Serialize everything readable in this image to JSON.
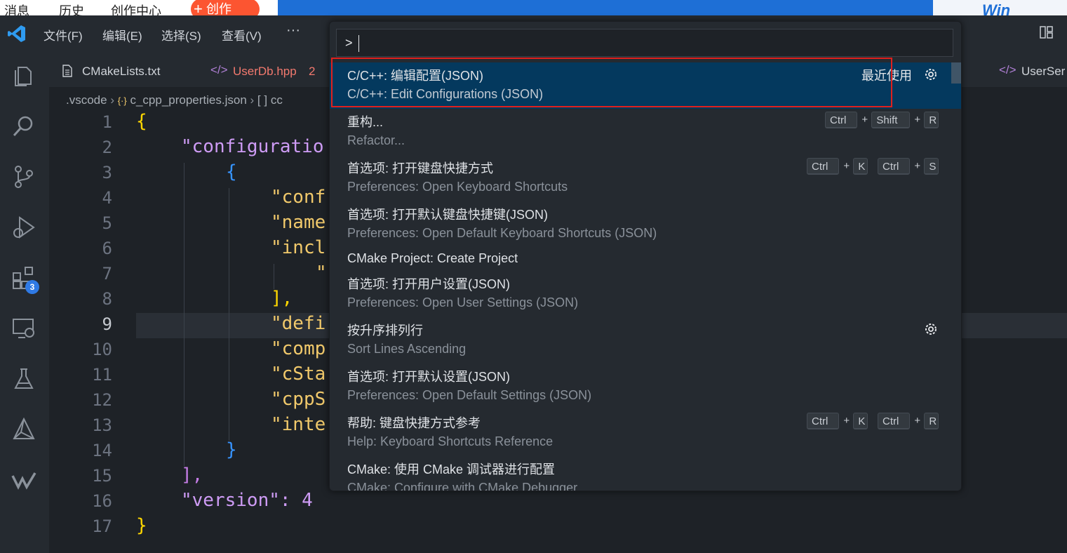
{
  "browser": {
    "tabs": [
      "消息",
      "历史",
      "创作中心"
    ],
    "create_button": "创作",
    "right_text": "Win"
  },
  "titlebar": {
    "menus": [
      "文件(F)",
      "编辑(E)",
      "选择(S)",
      "查看(V)"
    ],
    "more": "···"
  },
  "activity": {
    "extensions_badge": "3"
  },
  "tabs": [
    {
      "label": "CMakeLists.txt",
      "color": "#d0d4da"
    },
    {
      "label": "UserDb.hpp",
      "badge": "2",
      "color": "#f2796e"
    },
    {
      "label": "UserSer",
      "color": "#d0d4da"
    }
  ],
  "breadcrumb": {
    "folder": ".vscode",
    "file": "c_cpp_properties.json",
    "symbol": "[ ] cc"
  },
  "editor": {
    "line_numbers": [
      "1",
      "2",
      "3",
      "4",
      "5",
      "6",
      "7",
      "8",
      "9",
      "10",
      "11",
      "12",
      "13",
      "14",
      "15",
      "16",
      "17"
    ],
    "current_line": "9",
    "lines": [
      "{",
      "\"configuratio",
      "{",
      "\"conf",
      "\"name",
      "\"incl",
      "\"",
      "],",
      "\"defi",
      "\"comp",
      "\"cSta",
      "\"cppS",
      "\"inte",
      "}",
      "],",
      "\"version\": 4",
      "}"
    ]
  },
  "palette": {
    "input_value": ">",
    "recent_label": "最近使用",
    "items": [
      {
        "title": "C/C++: 编辑配置(JSON)",
        "subtitle": "C/C++: Edit Configurations (JSON)",
        "selected": true
      },
      {
        "title": "重构...",
        "subtitle": "Refactor...",
        "keys": [
          [
            "Ctrl",
            "Shift",
            "R"
          ]
        ]
      },
      {
        "title": "首选项: 打开键盘快捷方式",
        "subtitle": "Preferences: Open Keyboard Shortcuts",
        "keys": [
          [
            "Ctrl",
            "K"
          ],
          [
            "Ctrl",
            "S"
          ]
        ]
      },
      {
        "title": "首选项: 打开默认键盘快捷键(JSON)",
        "subtitle": "Preferences: Open Default Keyboard Shortcuts (JSON)"
      },
      {
        "title": "CMake Project: Create Project",
        "subtitle": ""
      },
      {
        "title": "首选项: 打开用户设置(JSON)",
        "subtitle": "Preferences: Open User Settings (JSON)"
      },
      {
        "title": "按升序排列行",
        "subtitle": "Sort Lines Ascending",
        "gear": true
      },
      {
        "title": "首选项: 打开默认设置(JSON)",
        "subtitle": "Preferences: Open Default Settings (JSON)"
      },
      {
        "title": "帮助: 键盘快捷方式参考",
        "subtitle": "Help: Keyboard Shortcuts Reference",
        "keys": [
          [
            "Ctrl",
            "K"
          ],
          [
            "Ctrl",
            "R"
          ]
        ]
      },
      {
        "title": "CMake: 使用 CMake 调试器进行配置",
        "subtitle": "CMake: Configure with CMake Debugger"
      }
    ]
  },
  "colors": {
    "accent_selection": "#04395e",
    "highlight_box": "#e0201d",
    "json_key": "#ce9cf5",
    "json_string_quote": "#f1c96b",
    "brace": "#ffd700",
    "bracket_blue": "#3794ff",
    "number": "#c57de6"
  }
}
